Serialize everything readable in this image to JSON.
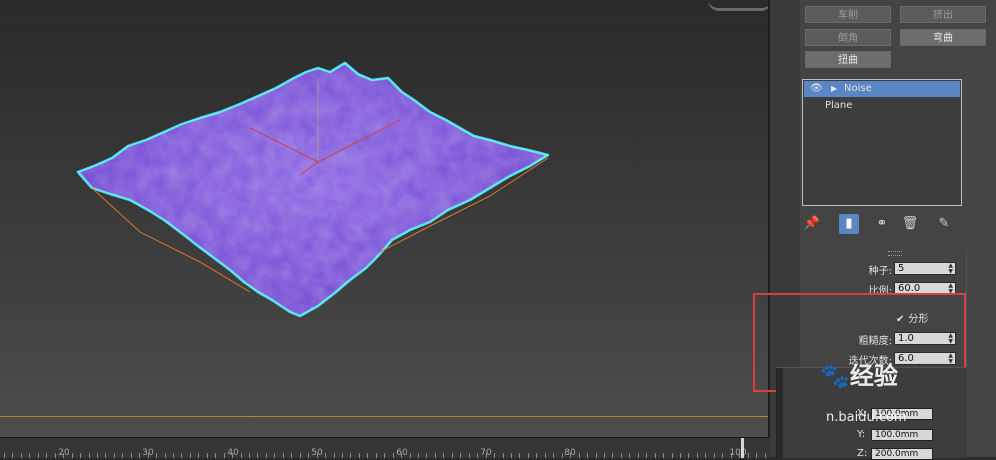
{
  "modifier_buttons": [
    {
      "label": "车削",
      "active": false
    },
    {
      "label": "挤出",
      "active": false
    },
    {
      "label": "倒角",
      "active": false
    },
    {
      "label": "弯曲",
      "active": true
    },
    {
      "label": "扭曲",
      "active": true
    }
  ],
  "modifier_stack": {
    "items": [
      {
        "label": "Noise",
        "selected": true
      },
      {
        "label": "Plane",
        "selected": false
      }
    ]
  },
  "stack_tools": [
    "pin-icon",
    "show-end-result-icon",
    "make-unique-icon",
    "remove-modifier-icon",
    "configure-icon"
  ],
  "noise_params": {
    "seed_label": "种子:",
    "seed_value": "5",
    "scale_label": "比例:",
    "scale_value": "60.0",
    "fractal_label": "分形",
    "fractal_checked": true,
    "roughness_label": "粗糙度:",
    "roughness_value": "1.0",
    "iterations_label": "迭代次数:",
    "iterations_value": "6.0"
  },
  "strength": {
    "x_label": "X:",
    "x_value": "100.0mm",
    "y_label": "Y:",
    "y_value": "100.0mm",
    "z_label": "Z:",
    "z_value": "200.0mm"
  },
  "timeline": {
    "ticks": [
      "20",
      "30",
      "40",
      "50",
      "60",
      "70",
      "80",
      "100"
    ]
  },
  "watermark": {
    "brand": "经验",
    "url": "n.baidu.com"
  },
  "colors": {
    "mesh": "#7a4fd6",
    "selection_outline": "#4fe3f0",
    "stack_selected": "#5a86c6",
    "highlight_box": "#d8403f"
  }
}
